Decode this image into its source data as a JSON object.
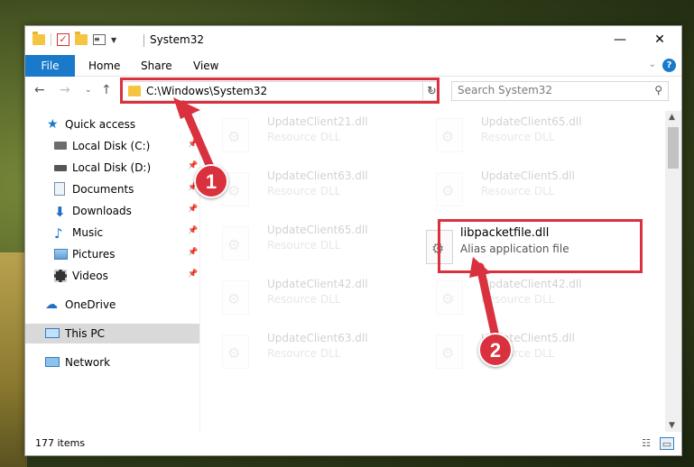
{
  "window": {
    "title": "System32",
    "controls": {
      "minimize": "—",
      "maximize": "☐",
      "close": "✕"
    }
  },
  "ribbon": {
    "tabs": [
      "File",
      "Home",
      "Share",
      "View"
    ],
    "help": "?"
  },
  "address": {
    "path": "C:\\Windows\\System32",
    "search_placeholder": "Search System32"
  },
  "sidebar": {
    "items": [
      {
        "label": "Quick access",
        "icon": "star-icon"
      },
      {
        "label": "Local Disk (C:)",
        "icon": "drive-icon",
        "pinned": true
      },
      {
        "label": "Local Disk (D:)",
        "icon": "drive-icon",
        "pinned": true
      },
      {
        "label": "Documents",
        "icon": "documents-icon",
        "pinned": true
      },
      {
        "label": "Downloads",
        "icon": "download-icon",
        "pinned": true
      },
      {
        "label": "Music",
        "icon": "music-icon",
        "pinned": true
      },
      {
        "label": "Pictures",
        "icon": "pictures-icon",
        "pinned": true
      },
      {
        "label": "Videos",
        "icon": "videos-icon",
        "pinned": true
      },
      {
        "label": "OneDrive",
        "icon": "cloud-icon"
      },
      {
        "label": "This PC",
        "icon": "computer-icon",
        "selected": true
      },
      {
        "label": "Network",
        "icon": "network-icon"
      }
    ]
  },
  "files": [
    {
      "name": "UpdateClient21.dll",
      "type": "Resource DLL"
    },
    {
      "name": "UpdateClient65.dll",
      "type": "Resource DLL"
    },
    {
      "name": "UpdateClient63.dll",
      "type": "Resource DLL"
    },
    {
      "name": "UpdateClient5.dll",
      "type": "Resource DLL"
    },
    {
      "name": "UpdateClient65.dll",
      "type": "Resource DLL"
    },
    {
      "name": "libpacketfile.dll",
      "type": "Alias application file"
    },
    {
      "name": "UpdateClient42.dll",
      "type": "Resource DLL"
    },
    {
      "name": "UpdateClient42.dll",
      "type": "Resource DLL"
    },
    {
      "name": "UpdateClient63.dll",
      "type": "Resource DLL"
    },
    {
      "name": "UpdateClient5.dll",
      "type": "Resource DLL"
    }
  ],
  "status": {
    "item_count": "177 items"
  },
  "annotations": {
    "step1": "1",
    "step2": "2"
  },
  "colors": {
    "accent": "#1979ca",
    "highlight": "#d9323e",
    "selection": "#cce8ff"
  }
}
